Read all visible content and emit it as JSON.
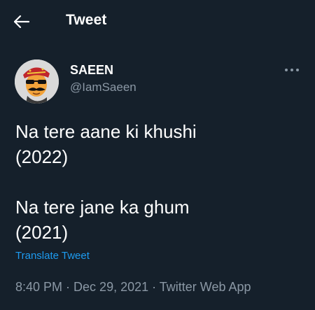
{
  "header": {
    "title": "Tweet",
    "back_icon": "arrow-left-icon"
  },
  "author": {
    "name": "SAEEN",
    "handle": "@IamSaeen",
    "avatar_icon": "cartoon-avatar"
  },
  "more_icon": "ellipsis-icon",
  "tweet": {
    "text_1": "Na tere aane ki khushi\n(2022)",
    "text_2": "Na tere jane ka ghum\n(2021)"
  },
  "translate_label": "Translate Tweet",
  "meta": {
    "time": "8:40 PM",
    "sep1": " · ",
    "date": "Dec 29, 2021",
    "sep2": " · ",
    "source": "Twitter Web App"
  },
  "colors": {
    "background": "#15202b",
    "text": "#ffffff",
    "secondary": "#8b98a5",
    "link": "#1d9bf0"
  }
}
